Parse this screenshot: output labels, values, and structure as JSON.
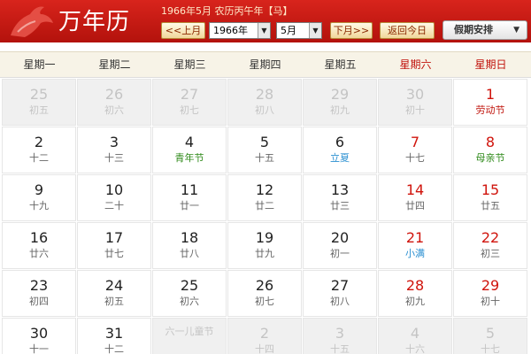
{
  "header": {
    "logo_text": "万年历",
    "subtitle": "1966年5月 农历丙午年【马】",
    "prev_label": "<<上月",
    "next_label": "下月>>",
    "today_label": "返回今日",
    "year_value": "1966年",
    "month_value": "5月",
    "holiday_label": "假期安排",
    "brand_color": "#c41a12"
  },
  "weekdays": [
    "星期一",
    "星期二",
    "星期三",
    "星期四",
    "星期五",
    "星期六",
    "星期日"
  ],
  "cells": [
    {
      "day": "25",
      "lunar": "初五",
      "other": true
    },
    {
      "day": "26",
      "lunar": "初六",
      "other": true
    },
    {
      "day": "27",
      "lunar": "初七",
      "other": true
    },
    {
      "day": "28",
      "lunar": "初八",
      "other": true
    },
    {
      "day": "29",
      "lunar": "初九",
      "other": true
    },
    {
      "day": "30",
      "lunar": "初十",
      "other": true
    },
    {
      "day": "1",
      "lunar": "劳动节",
      "red": true,
      "kind": "fest-red"
    },
    {
      "day": "2",
      "lunar": "十二"
    },
    {
      "day": "3",
      "lunar": "十三"
    },
    {
      "day": "4",
      "lunar": "青年节",
      "kind": "fest-green"
    },
    {
      "day": "5",
      "lunar": "十五"
    },
    {
      "day": "6",
      "lunar": "立夏",
      "kind": "term-blue"
    },
    {
      "day": "7",
      "lunar": "十七",
      "red": true
    },
    {
      "day": "8",
      "lunar": "母亲节",
      "red": true,
      "kind": "fest-green"
    },
    {
      "day": "9",
      "lunar": "十九"
    },
    {
      "day": "10",
      "lunar": "二十"
    },
    {
      "day": "11",
      "lunar": "廿一"
    },
    {
      "day": "12",
      "lunar": "廿二"
    },
    {
      "day": "13",
      "lunar": "廿三"
    },
    {
      "day": "14",
      "lunar": "廿四",
      "red": true
    },
    {
      "day": "15",
      "lunar": "廿五",
      "red": true
    },
    {
      "day": "16",
      "lunar": "廿六"
    },
    {
      "day": "17",
      "lunar": "廿七"
    },
    {
      "day": "18",
      "lunar": "廿八"
    },
    {
      "day": "19",
      "lunar": "廿九"
    },
    {
      "day": "20",
      "lunar": "初一"
    },
    {
      "day": "21",
      "lunar": "小满",
      "red": true,
      "kind": "term-blue"
    },
    {
      "day": "22",
      "lunar": "初三",
      "red": true
    },
    {
      "day": "23",
      "lunar": "初四"
    },
    {
      "day": "24",
      "lunar": "初五"
    },
    {
      "day": "25",
      "lunar": "初六"
    },
    {
      "day": "26",
      "lunar": "初七"
    },
    {
      "day": "27",
      "lunar": "初八"
    },
    {
      "day": "28",
      "lunar": "初九",
      "red": true
    },
    {
      "day": "29",
      "lunar": "初十",
      "red": true
    },
    {
      "day": "30",
      "lunar": "十一"
    },
    {
      "day": "31",
      "lunar": "十二"
    },
    {
      "day": "",
      "lunar": "六一儿童节",
      "other": true,
      "kind": "fest-green"
    },
    {
      "day": "2",
      "lunar": "十四",
      "other": true
    },
    {
      "day": "3",
      "lunar": "十五",
      "other": true
    },
    {
      "day": "4",
      "lunar": "十六",
      "other": true
    },
    {
      "day": "5",
      "lunar": "十七",
      "other": true
    }
  ]
}
